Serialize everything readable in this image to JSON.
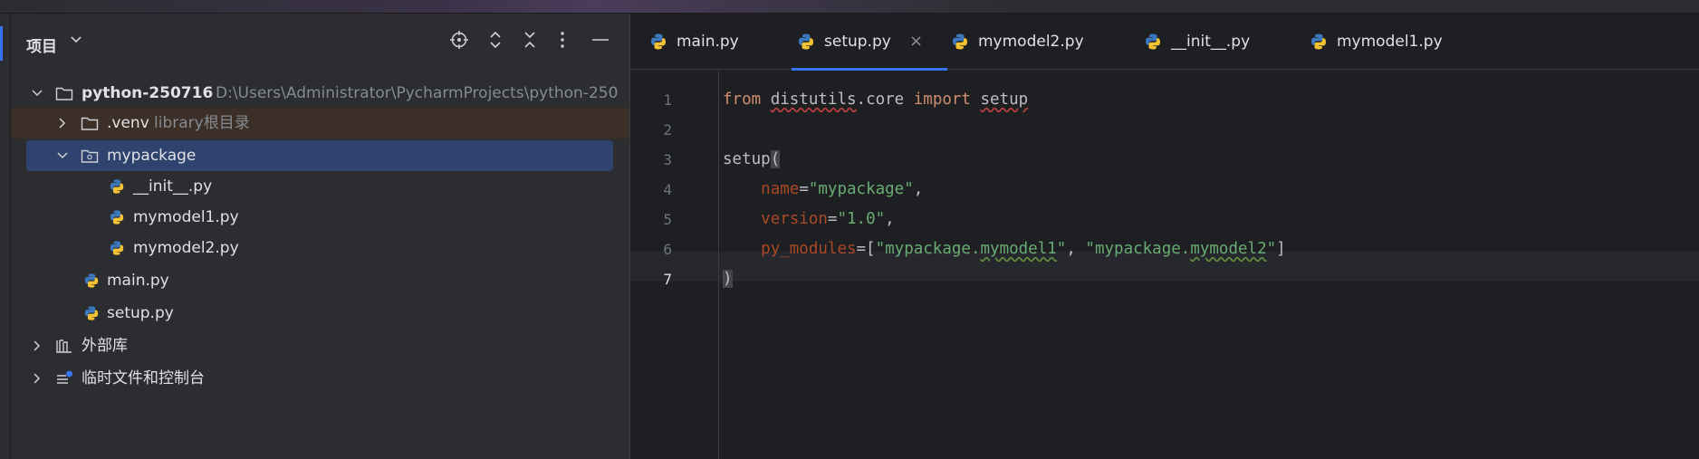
{
  "project_panel": {
    "title": "项目",
    "tree": [
      {
        "label": "python-250716",
        "hint": "D:\\Users\\Administrator\\PycharmProjects\\python-250"
      },
      {
        "label": ".venv",
        "hint": "library根目录"
      },
      {
        "label": "mypackage"
      },
      {
        "label": "__init__.py"
      },
      {
        "label": "mymodel1.py"
      },
      {
        "label": "mymodel2.py"
      },
      {
        "label": "main.py"
      },
      {
        "label": "setup.py"
      },
      {
        "label": "外部库"
      },
      {
        "label": "临时文件和控制台"
      }
    ]
  },
  "editor": {
    "tabs": [
      {
        "label": "main.py"
      },
      {
        "label": "setup.py",
        "active": true
      },
      {
        "label": "mymodel2.py"
      },
      {
        "label": "__init__.py"
      },
      {
        "label": "mymodel1.py"
      }
    ],
    "close_glyph": "×",
    "line_numbers": [
      "1",
      "2",
      "3",
      "4",
      "5",
      "6",
      "7"
    ],
    "code": {
      "l1_from": "from",
      "l1_module": "distutils",
      "l1_rest": ".core ",
      "l1_import": "import",
      "l1_name": "setup",
      "l3_call": "setup",
      "l3_paren": "(",
      "l4_param": "name",
      "l4_value": "\"mypackage\"",
      "l5_param": "version",
      "l5_value": "\"1.0\"",
      "l6_param": "py_modules",
      "l6_v1_a": "\"mypackage.",
      "l6_v1_b": "mymodel1",
      "l6_v1_c": "\"",
      "l6_v2_a": "\"mypackage.",
      "l6_v2_b": "mymodel2",
      "l6_v2_c": "\"",
      "l7_paren": ")"
    }
  },
  "colors": {
    "accent": "#3574f0",
    "keyword": "#cf8e6d",
    "string": "#6aab73",
    "param": "#aa4926"
  }
}
